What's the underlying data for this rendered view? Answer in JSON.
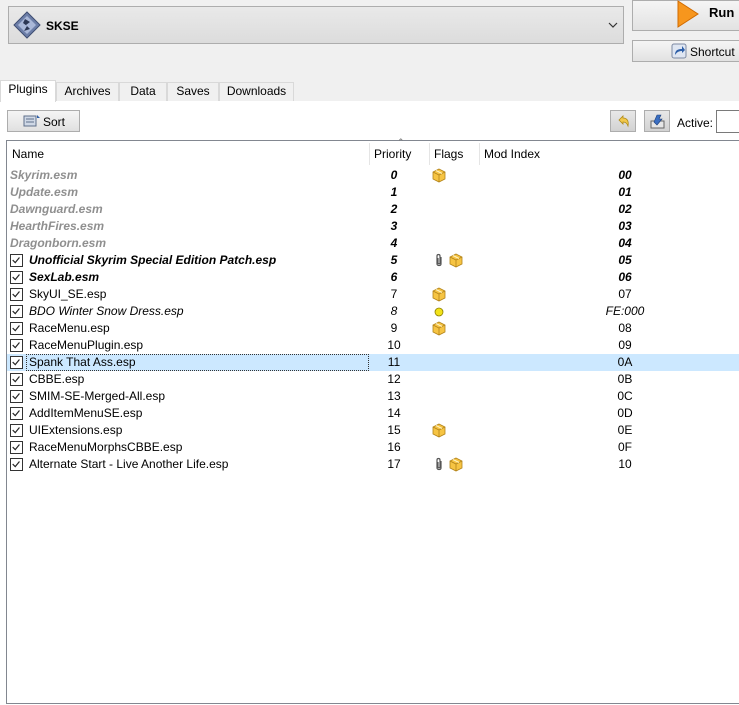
{
  "executable": {
    "name": "SKSE"
  },
  "run_label": "Run",
  "shortcut_label": "Shortcut",
  "tabs": [
    "Plugins",
    "Archives",
    "Data",
    "Saves",
    "Downloads"
  ],
  "active_tab": "Plugins",
  "toolbar": {
    "sort_label": "Sort",
    "active_label": "Active:",
    "active_value": ""
  },
  "columns": {
    "name": "Name",
    "priority": "Priority",
    "flags": "Flags",
    "mod_index": "Mod Index"
  },
  "colors": {
    "selection": "#cce8ff",
    "master_text": "#8f8f8f",
    "run_accent": "#f28c0f"
  },
  "plugins": [
    {
      "name": "Skyrim.esm",
      "priority": "0",
      "mod_index": "00",
      "checkbox": false,
      "checked": false,
      "style": "master",
      "flags": [
        "package-icon"
      ]
    },
    {
      "name": "Update.esm",
      "priority": "1",
      "mod_index": "01",
      "checkbox": false,
      "checked": false,
      "style": "master",
      "flags": []
    },
    {
      "name": "Dawnguard.esm",
      "priority": "2",
      "mod_index": "02",
      "checkbox": false,
      "checked": false,
      "style": "master",
      "flags": []
    },
    {
      "name": "HearthFires.esm",
      "priority": "3",
      "mod_index": "03",
      "checkbox": false,
      "checked": false,
      "style": "master",
      "flags": []
    },
    {
      "name": "Dragonborn.esm",
      "priority": "4",
      "mod_index": "04",
      "checkbox": false,
      "checked": false,
      "style": "master",
      "flags": []
    },
    {
      "name": "Unofficial Skyrim Special Edition Patch.esp",
      "priority": "5",
      "mod_index": "05",
      "checkbox": true,
      "checked": true,
      "style": "bold",
      "flags": [
        "paperclip-icon",
        "package-icon"
      ]
    },
    {
      "name": "SexLab.esm",
      "priority": "6",
      "mod_index": "06",
      "checkbox": true,
      "checked": true,
      "style": "bold",
      "flags": []
    },
    {
      "name": "SkyUI_SE.esp",
      "priority": "7",
      "mod_index": "07",
      "checkbox": true,
      "checked": true,
      "style": "normal",
      "flags": [
        "package-icon"
      ]
    },
    {
      "name": "BDO Winter Snow Dress.esp",
      "priority": "8",
      "mod_index": "FE:000",
      "checkbox": true,
      "checked": true,
      "style": "italic",
      "flags": [
        "light-plugin-icon"
      ]
    },
    {
      "name": "RaceMenu.esp",
      "priority": "9",
      "mod_index": "08",
      "checkbox": true,
      "checked": true,
      "style": "normal",
      "flags": [
        "package-icon"
      ]
    },
    {
      "name": "RaceMenuPlugin.esp",
      "priority": "10",
      "mod_index": "09",
      "checkbox": true,
      "checked": true,
      "style": "normal",
      "flags": []
    },
    {
      "name": "Spank That Ass.esp",
      "priority": "11",
      "mod_index": "0A",
      "checkbox": true,
      "checked": true,
      "style": "normal",
      "flags": [],
      "selected": true
    },
    {
      "name": "CBBE.esp",
      "priority": "12",
      "mod_index": "0B",
      "checkbox": true,
      "checked": true,
      "style": "normal",
      "flags": []
    },
    {
      "name": "SMIM-SE-Merged-All.esp",
      "priority": "13",
      "mod_index": "0C",
      "checkbox": true,
      "checked": true,
      "style": "normal",
      "flags": []
    },
    {
      "name": "AddItemMenuSE.esp",
      "priority": "14",
      "mod_index": "0D",
      "checkbox": true,
      "checked": true,
      "style": "normal",
      "flags": []
    },
    {
      "name": "UIExtensions.esp",
      "priority": "15",
      "mod_index": "0E",
      "checkbox": true,
      "checked": true,
      "style": "normal",
      "flags": [
        "package-icon"
      ]
    },
    {
      "name": "RaceMenuMorphsCBBE.esp",
      "priority": "16",
      "mod_index": "0F",
      "checkbox": true,
      "checked": true,
      "style": "normal",
      "flags": []
    },
    {
      "name": "Alternate Start - Live Another Life.esp",
      "priority": "17",
      "mod_index": "10",
      "checkbox": true,
      "checked": true,
      "style": "normal",
      "flags": [
        "paperclip-icon",
        "package-icon"
      ]
    }
  ]
}
